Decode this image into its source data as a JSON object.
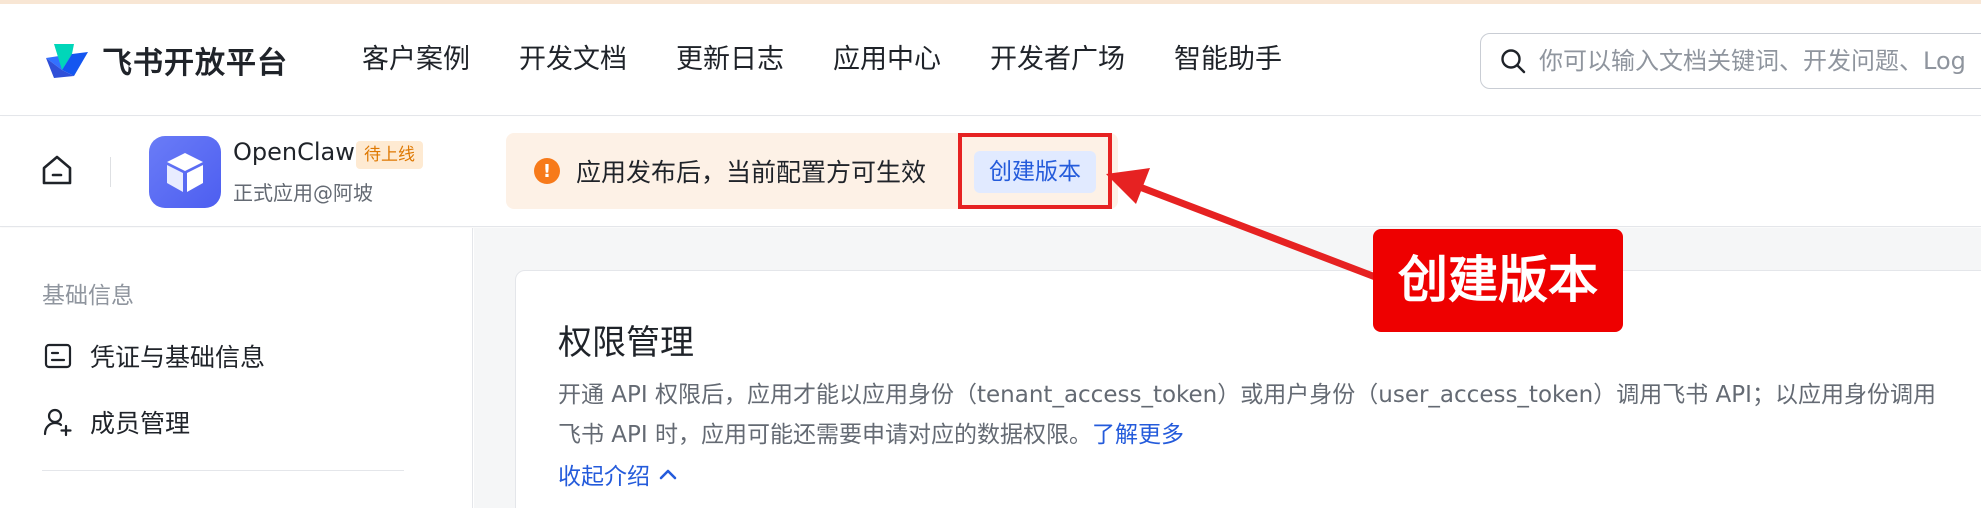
{
  "nav": {
    "logo_text": "飞书开放平台",
    "items": [
      {
        "label": "客户案例"
      },
      {
        "label": "开发文档"
      },
      {
        "label": "更新日志"
      },
      {
        "label": "应用中心"
      },
      {
        "label": "开发者广场"
      },
      {
        "label": "智能助手"
      }
    ],
    "search_placeholder": "你可以输入文档关键词、开发问题、Log"
  },
  "app": {
    "name": "OpenClaw",
    "badge": "待上线",
    "subtitle": "正式应用@阿坡",
    "icon": "cube-icon"
  },
  "notice": {
    "text": "应用发布后，当前配置方可生效",
    "action_label": "创建版本",
    "icon": "warning-icon"
  },
  "annotation": {
    "callout_text": "创建版本",
    "color": "#ee0000"
  },
  "sidebar": {
    "section_label": "基础信息",
    "items": [
      {
        "label": "凭证与基础信息",
        "icon": "id-card-icon"
      },
      {
        "label": "成员管理",
        "icon": "user-add-icon"
      }
    ]
  },
  "main": {
    "title": "权限管理",
    "description": "开通 API 权限后，应用才能以应用身份（tenant_access_token）或用户身份（user_access_token）调用飞书 API；以应用身份调用飞书 API 时，应用可能还需要申请对应的数据权限。",
    "learn_more": "了解更多",
    "collapse_label": "收起介绍"
  },
  "colors": {
    "link": "#245bdb",
    "badge_bg": "#feead2",
    "badge_text": "#de7802",
    "notice_bg": "#fdf1e6",
    "warning": "#f77a1a",
    "annotation_red": "#e62222"
  }
}
